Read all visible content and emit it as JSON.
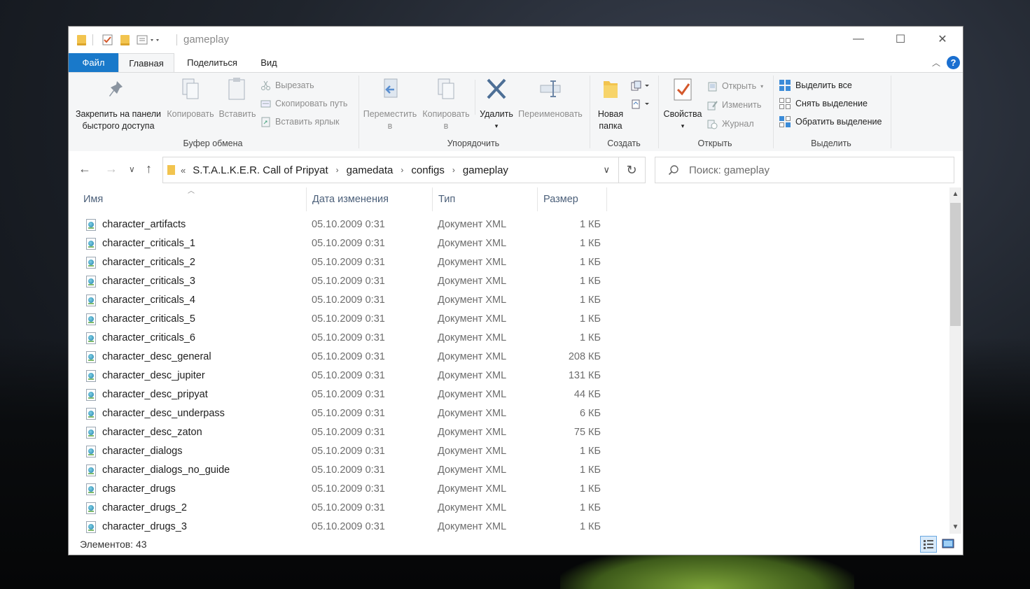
{
  "window": {
    "title": "gameplay",
    "controls": {
      "minimize": "—",
      "maximize": "☐",
      "close": "✕"
    }
  },
  "ribbon_tabs": [
    "Файл",
    "Главная",
    "Поделиться",
    "Вид"
  ],
  "ribbon": {
    "clipboard": {
      "label": "Буфер обмена",
      "pin_line1": "Закрепить на панели",
      "pin_line2": "быстрого доступа",
      "copy": "Копировать",
      "paste": "Вставить",
      "cut": "Вырезать",
      "copy_path": "Скопировать путь",
      "paste_shortcut": "Вставить ярлык"
    },
    "organize": {
      "label": "Упорядочить",
      "move_to_line1": "Переместить",
      "move_to_line2": "в",
      "copy_to_line1": "Копировать",
      "copy_to_line2": "в",
      "delete": "Удалить",
      "rename": "Переименовать"
    },
    "new": {
      "label": "Создать",
      "new_folder_line1": "Новая",
      "new_folder_line2": "папка"
    },
    "open": {
      "label": "Открыть",
      "properties": "Свойства",
      "open": "Открыть",
      "edit": "Изменить",
      "history": "Журнал"
    },
    "select": {
      "label": "Выделить",
      "select_all": "Выделить все",
      "select_none": "Снять выделение",
      "invert": "Обратить выделение"
    }
  },
  "address": {
    "overflow": "«",
    "crumbs": [
      "S.T.A.L.K.E.R. Call of Pripyat",
      "gamedata",
      "configs",
      "gameplay"
    ]
  },
  "search": {
    "placeholder": "Поиск: gameplay"
  },
  "columns": {
    "name": "Имя",
    "date": "Дата изменения",
    "type": "Тип",
    "size": "Размер"
  },
  "files": [
    {
      "name": "character_artifacts",
      "date": "05.10.2009 0:31",
      "type": "Документ XML",
      "size": "1 КБ"
    },
    {
      "name": "character_criticals_1",
      "date": "05.10.2009 0:31",
      "type": "Документ XML",
      "size": "1 КБ"
    },
    {
      "name": "character_criticals_2",
      "date": "05.10.2009 0:31",
      "type": "Документ XML",
      "size": "1 КБ"
    },
    {
      "name": "character_criticals_3",
      "date": "05.10.2009 0:31",
      "type": "Документ XML",
      "size": "1 КБ"
    },
    {
      "name": "character_criticals_4",
      "date": "05.10.2009 0:31",
      "type": "Документ XML",
      "size": "1 КБ"
    },
    {
      "name": "character_criticals_5",
      "date": "05.10.2009 0:31",
      "type": "Документ XML",
      "size": "1 КБ"
    },
    {
      "name": "character_criticals_6",
      "date": "05.10.2009 0:31",
      "type": "Документ XML",
      "size": "1 КБ"
    },
    {
      "name": "character_desc_general",
      "date": "05.10.2009 0:31",
      "type": "Документ XML",
      "size": "208 КБ"
    },
    {
      "name": "character_desc_jupiter",
      "date": "05.10.2009 0:31",
      "type": "Документ XML",
      "size": "131 КБ"
    },
    {
      "name": "character_desc_pripyat",
      "date": "05.10.2009 0:31",
      "type": "Документ XML",
      "size": "44 КБ"
    },
    {
      "name": "character_desc_underpass",
      "date": "05.10.2009 0:31",
      "type": "Документ XML",
      "size": "6 КБ"
    },
    {
      "name": "character_desc_zaton",
      "date": "05.10.2009 0:31",
      "type": "Документ XML",
      "size": "75 КБ"
    },
    {
      "name": "character_dialogs",
      "date": "05.10.2009 0:31",
      "type": "Документ XML",
      "size": "1 КБ"
    },
    {
      "name": "character_dialogs_no_guide",
      "date": "05.10.2009 0:31",
      "type": "Документ XML",
      "size": "1 КБ"
    },
    {
      "name": "character_drugs",
      "date": "05.10.2009 0:31",
      "type": "Документ XML",
      "size": "1 КБ"
    },
    {
      "name": "character_drugs_2",
      "date": "05.10.2009 0:31",
      "type": "Документ XML",
      "size": "1 КБ"
    },
    {
      "name": "character_drugs_3",
      "date": "05.10.2009 0:31",
      "type": "Документ XML",
      "size": "1 КБ"
    }
  ],
  "status": {
    "items": "Элементов: 43"
  }
}
